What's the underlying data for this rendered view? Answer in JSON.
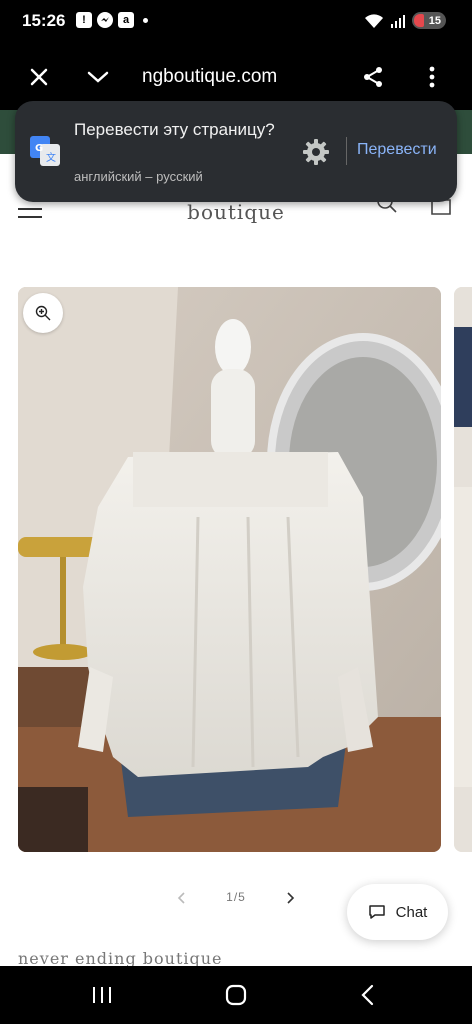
{
  "status_bar": {
    "time": "15:26",
    "battery_level": "15"
  },
  "browser": {
    "url": "ngboutique.com",
    "close_icon": "close-icon",
    "dropdown_icon": "chevron-down-icon",
    "share_icon": "share-icon",
    "menu_icon": "more-vert-icon"
  },
  "site_header": {
    "brand": "boutique",
    "accent_color": "#2e4d3b"
  },
  "translate_popup": {
    "title": "Перевести эту страницу?",
    "languages": "английский – русский",
    "action_label": "Перевести",
    "settings_icon": "gear-icon"
  },
  "gallery": {
    "counter": "1/5",
    "current": 1,
    "total": 5
  },
  "chat": {
    "label": "Chat"
  },
  "product": {
    "vendor": "never ending boutique"
  }
}
